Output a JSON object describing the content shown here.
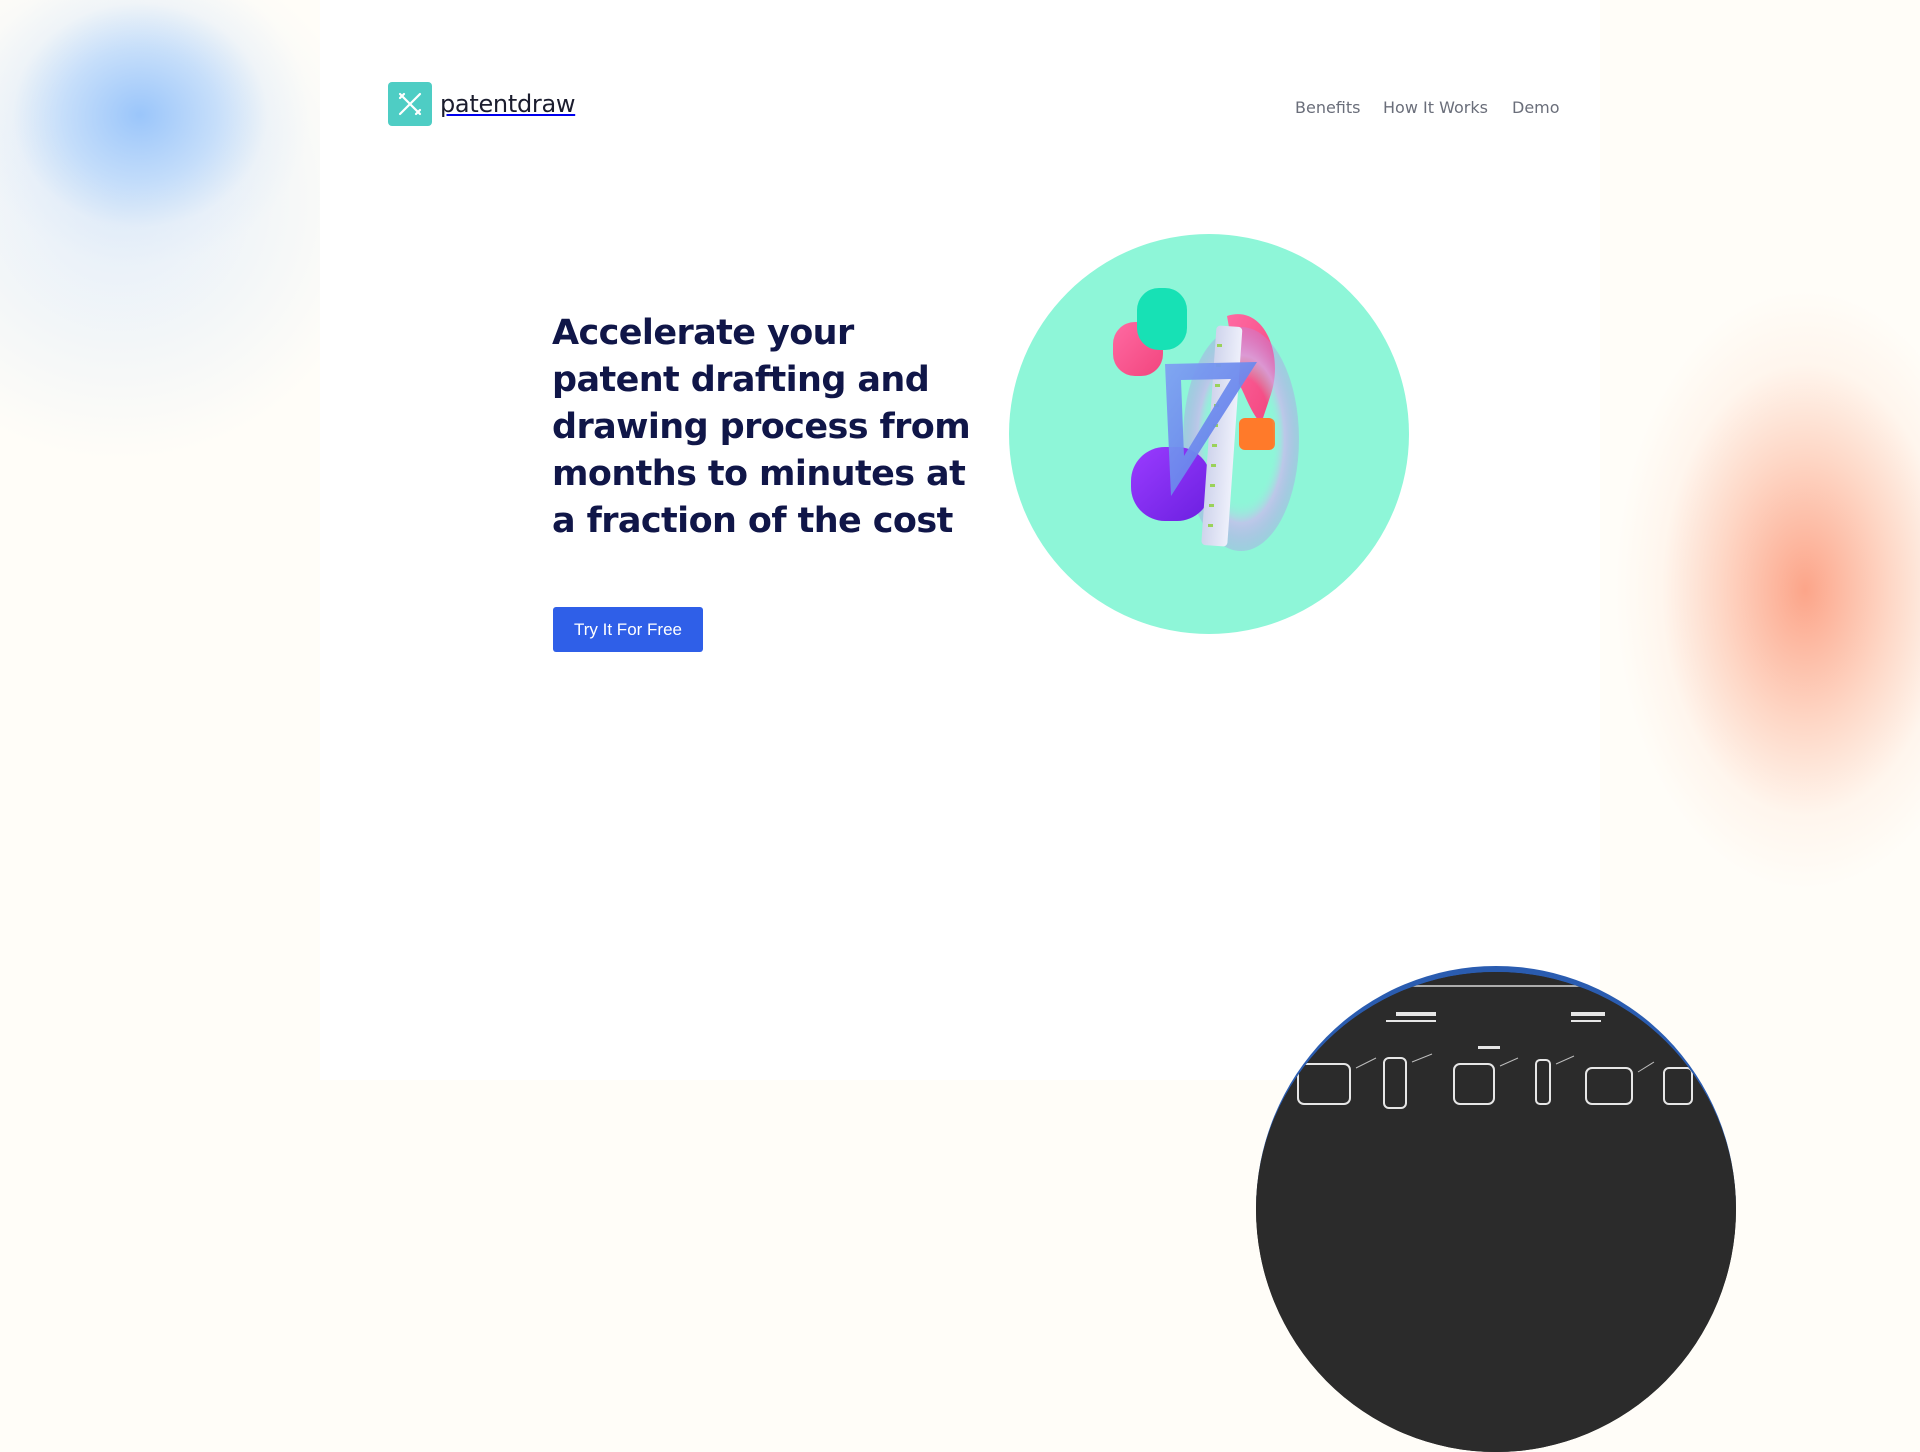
{
  "brand": {
    "name": "patentdraw"
  },
  "nav": {
    "items": [
      "Benefits",
      "How It Works",
      "Demo"
    ]
  },
  "hero": {
    "headline": "Accelerate your patent drafting and drawing process from months to minutes at a fraction of the cost",
    "cta_label": "Try It For Free",
    "illustration": "3d-drafting-tools-illustration"
  },
  "preview": {
    "illustration": "patent-drawing-sheet"
  },
  "colors": {
    "headline": "#101648",
    "cta": "#2f5fe8",
    "logo": "#4ecdc4",
    "hero_circle": "#8ef6d8",
    "nav_text": "#6a6e7a"
  }
}
